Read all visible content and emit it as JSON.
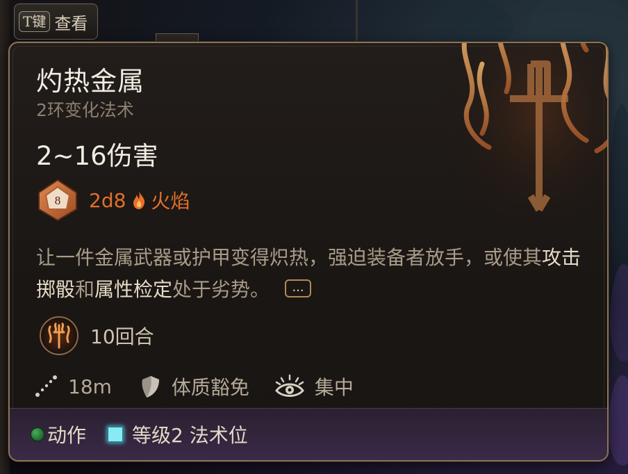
{
  "hint": {
    "key": "T键",
    "label": "查看"
  },
  "spell": {
    "name": "灼热金属",
    "level": "2环变化法术",
    "damage_headline": "2~16伤害",
    "dice_face": "8",
    "dice": "2d8",
    "damage_type": "火焰",
    "description": {
      "part1": "让一件金属武器或护甲变得炽热，强迫装备者放手，或使其",
      "kw1": "攻击掷骰",
      "part2": "和",
      "kw2": "属性检定",
      "part3": "处于劣势。"
    },
    "more_label": "...",
    "duration": "10回合",
    "range": "18m",
    "saving_throw": "体质豁免",
    "concentration": "集中"
  },
  "footer": {
    "cost_label": "动作",
    "slot_label": "等级2 法术位"
  },
  "colors": {
    "damage_orange": "#e2702a",
    "spell_slot_cyan": "#8aeaf4",
    "action_green": "#4caa5a",
    "border_bronze": "#8a7358"
  },
  "icons": {
    "dice": "d8-dice-icon",
    "flame": "fire-icon",
    "duration": "heat-metal-spell-icon",
    "range": "range-icon",
    "saving_throw": "shield-icon",
    "concentration": "concentration-eye-icon"
  }
}
